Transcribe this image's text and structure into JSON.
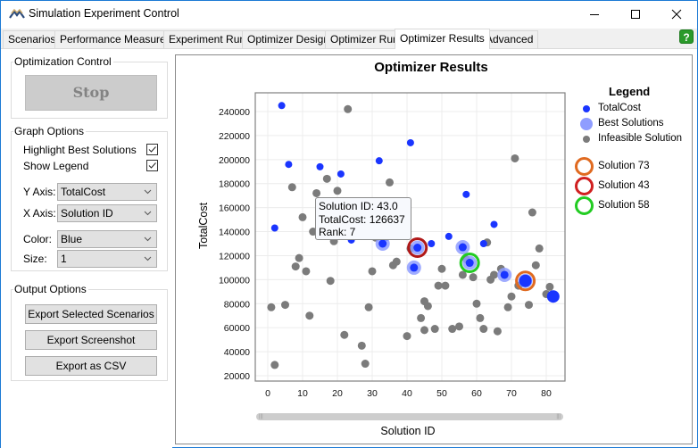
{
  "window": {
    "title": "Simulation Experiment Control",
    "icon": "app-logo-icon",
    "controls": [
      "minimize-icon",
      "maximize-icon",
      "close-icon"
    ]
  },
  "tabs": [
    {
      "label": "Scenarios",
      "active": false
    },
    {
      "label": "Performance Measures",
      "active": false
    },
    {
      "label": "Experiment Run",
      "active": false
    },
    {
      "label": "Optimizer Design",
      "active": false
    },
    {
      "label": "Optimizer Run",
      "active": false
    },
    {
      "label": "Optimizer Results",
      "active": true
    },
    {
      "label": "Advanced",
      "active": false
    }
  ],
  "help": {
    "label": "?",
    "icon": "help-icon"
  },
  "optimization_control": {
    "group_label": "Optimization Control",
    "stop_label": "Stop"
  },
  "graph_options": {
    "group_label": "Graph Options",
    "highlight_best_label": "Highlight Best Solutions",
    "highlight_best_checked": true,
    "show_legend_label": "Show Legend",
    "show_legend_checked": true,
    "y_axis_label": "Y Axis:",
    "y_axis_value": "TotalCost",
    "x_axis_label": "X Axis:",
    "x_axis_value": "Solution ID",
    "color_label": "Color:",
    "color_value": "Blue",
    "size_label": "Size:",
    "size_value": "1"
  },
  "output_options": {
    "group_label": "Output Options",
    "export_selected_label": "Export Selected Scenarios",
    "export_screenshot_label": "Export Screenshot",
    "export_csv_label": "Export as CSV"
  },
  "tooltip": {
    "line1": "Solution ID: 43.0",
    "line2": "TotalCost: 126637",
    "line3": "Rank: 7"
  },
  "colors": {
    "feasible": "#1a35ff",
    "best_halo": "#8f9dff",
    "infeasible": "#7b7b7b",
    "solution_73": "#e06a20",
    "solution_43": "#b01818",
    "solution_58": "#22cc22",
    "grid": "#ececec"
  },
  "chart_data": {
    "type": "scatter",
    "title": "Optimizer Results",
    "xlabel": "Solution ID",
    "ylabel": "TotalCost",
    "xlim": [
      -2,
      84
    ],
    "ylim": [
      20000,
      250000
    ],
    "xticks": [
      0,
      10,
      20,
      30,
      40,
      50,
      60,
      70,
      80
    ],
    "yticks": [
      20000,
      40000,
      60000,
      80000,
      100000,
      120000,
      140000,
      160000,
      180000,
      200000,
      220000,
      240000
    ],
    "xtick_labels": [
      "0",
      "10",
      "20",
      "30",
      "40",
      "50",
      "60",
      "70",
      "80"
    ],
    "ytick_labels": [
      "20000",
      "40000",
      "60000",
      "80000",
      "100000",
      "120000",
      "140000",
      "160000",
      "180000",
      "200000",
      "220000",
      "240000"
    ],
    "grid": true,
    "legend_position": "right",
    "legend": {
      "title": "Legend",
      "entries": [
        "TotalCost",
        "Best Solutions",
        "Infeasible Solution"
      ],
      "highlights": [
        "Solution 73",
        "Solution 43",
        "Solution 58"
      ]
    },
    "series": [
      {
        "name": "TotalCost",
        "points": [
          [
            4,
            245000
          ],
          [
            2,
            143000
          ],
          [
            6,
            196000
          ],
          [
            15,
            194000
          ],
          [
            21,
            188000
          ],
          [
            32,
            199000
          ],
          [
            41,
            214000
          ],
          [
            57,
            171000
          ],
          [
            65,
            146000
          ],
          [
            24,
            133000
          ],
          [
            34,
            135000
          ],
          [
            52,
            136000
          ],
          [
            62,
            130000
          ],
          [
            47,
            130000
          ],
          [
            82,
            86000
          ]
        ]
      },
      {
        "name": "Best Solutions",
        "points": [
          [
            33,
            130000
          ],
          [
            43,
            126637
          ],
          [
            42,
            110000
          ],
          [
            58,
            114000
          ],
          [
            68,
            104000
          ],
          [
            74,
            99000
          ],
          [
            56,
            127000
          ]
        ]
      },
      {
        "name": "Infeasible Solution",
        "points": [
          [
            1,
            77000
          ],
          [
            2,
            29000
          ],
          [
            5,
            79000
          ],
          [
            7,
            177000
          ],
          [
            8,
            111000
          ],
          [
            9,
            118000
          ],
          [
            10,
            152000
          ],
          [
            11,
            107000
          ],
          [
            12,
            70000
          ],
          [
            13,
            140000
          ],
          [
            14,
            172000
          ],
          [
            17,
            184000
          ],
          [
            18,
            99000
          ],
          [
            19,
            132000
          ],
          [
            20,
            174000
          ],
          [
            22,
            54000
          ],
          [
            23,
            242000
          ],
          [
            24,
            148000
          ],
          [
            27,
            45000
          ],
          [
            28,
            30000
          ],
          [
            29,
            77000
          ],
          [
            30,
            107000
          ],
          [
            31,
            135000
          ],
          [
            33,
            153000
          ],
          [
            35,
            181000
          ],
          [
            36,
            112000
          ],
          [
            37,
            115000
          ],
          [
            40,
            53000
          ],
          [
            41,
            126000
          ],
          [
            44,
            68000
          ],
          [
            45,
            58000
          ],
          [
            46,
            78000
          ],
          [
            48,
            59000
          ],
          [
            49,
            95000
          ],
          [
            50,
            109000
          ],
          [
            51,
            95000
          ],
          [
            53,
            59000
          ],
          [
            55,
            61000
          ],
          [
            56,
            104000
          ],
          [
            57,
            117000
          ],
          [
            59,
            102000
          ],
          [
            60,
            80000
          ],
          [
            61,
            68000
          ],
          [
            62,
            59000
          ],
          [
            63,
            131000
          ],
          [
            64,
            100000
          ],
          [
            65,
            104000
          ],
          [
            66,
            57000
          ],
          [
            67,
            109000
          ],
          [
            69,
            77000
          ],
          [
            70,
            86000
          ],
          [
            71,
            201000
          ],
          [
            72,
            95000
          ],
          [
            75,
            79000
          ],
          [
            76,
            156000
          ],
          [
            77,
            112000
          ],
          [
            80,
            88000
          ],
          [
            81,
            94000
          ],
          [
            78,
            126000
          ],
          [
            45,
            82000
          ],
          [
            35,
            155000
          ]
        ]
      }
    ],
    "highlighted_solutions": [
      {
        "label": "Solution 73",
        "x": 74,
        "y": 99000
      },
      {
        "label": "Solution 43",
        "x": 43,
        "y": 126637
      },
      {
        "label": "Solution 58",
        "x": 58,
        "y": 114000
      }
    ]
  }
}
